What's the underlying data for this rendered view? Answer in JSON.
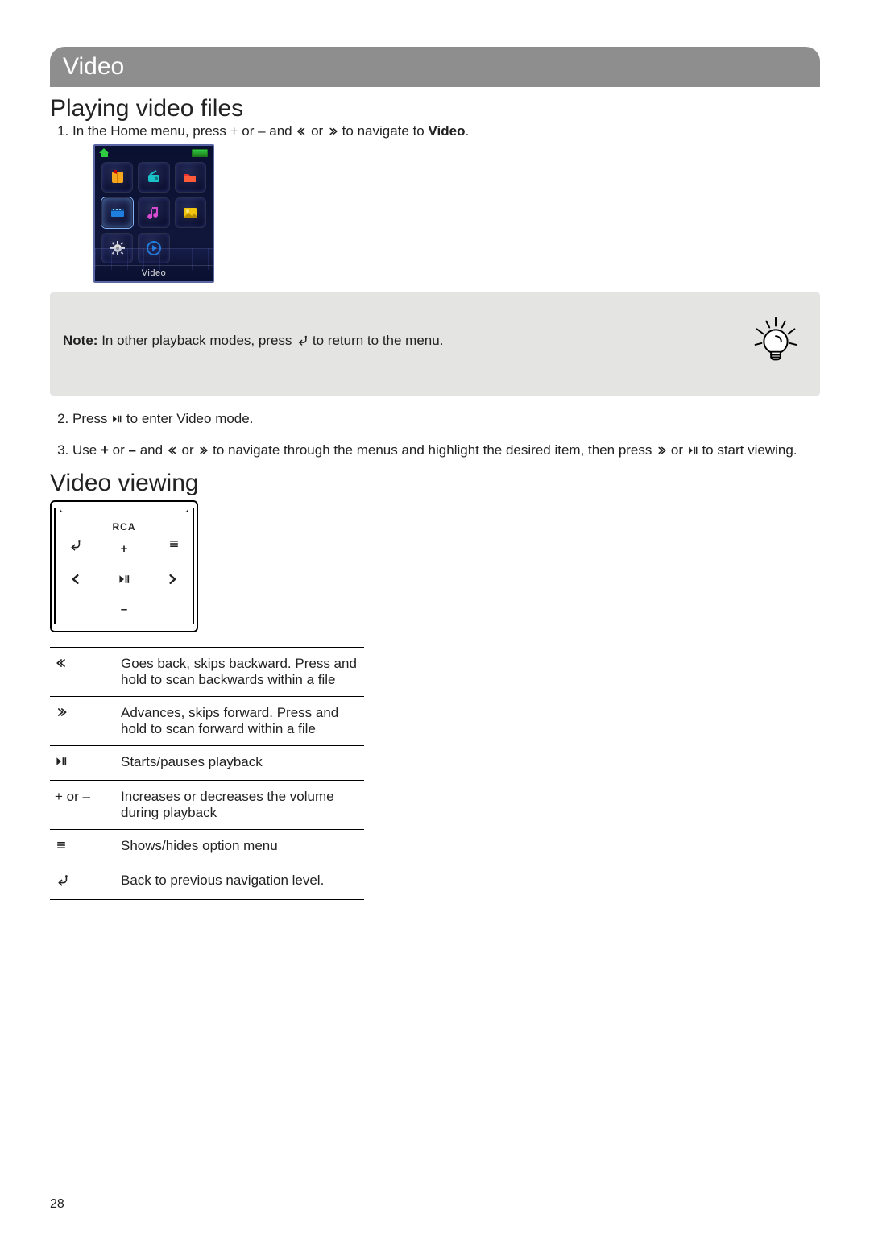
{
  "header": {
    "title": "Video"
  },
  "sections": {
    "playing": {
      "title": "Playing video files",
      "step1_pre": "In the Home menu, press + or – and ",
      "step1_mid": " or ",
      "step1_post": " to navigate to ",
      "step1_bold": "Video",
      "step1_end": ".",
      "device_label": "Video",
      "note_bold": "Note:",
      "note_rest": " In other playback modes, press ",
      "note_rest2": " to return to the menu.",
      "step2_pre": "Press ",
      "step2_post": " to enter Video mode.",
      "step3_pre": "Use ",
      "step3_a": "+",
      "step3_b": " or ",
      "step3_c": "–",
      "step3_d": " and ",
      "step3_e": " or ",
      "step3_f": " to navigate through the menus and highlight the desired item, then press ",
      "step3_g": " or ",
      "step3_h": " to start viewing."
    },
    "viewing": {
      "title": "Video viewing",
      "brand": "RCA"
    }
  },
  "controls_table": [
    {
      "key_icon": "skip-back-icon",
      "desc": "Goes back, skips backward. Press and hold to scan backwards within a file"
    },
    {
      "key_icon": "skip-fwd-icon",
      "desc": "Advances, skips forward. Press and hold to scan forward within a file"
    },
    {
      "key_icon": "play-pause-icon",
      "desc": "Starts/pauses playback"
    },
    {
      "key_text": "+ or –",
      "desc": "Increases or decreases the volume during playback"
    },
    {
      "key_icon": "menu-icon",
      "desc": "Shows/hides option menu"
    },
    {
      "key_icon": "back-icon",
      "desc": "Back to previous navigation level."
    }
  ],
  "page_number": "28",
  "icons": {
    "skip_back": "«",
    "skip_fwd": "»",
    "plus": "+",
    "minus": "–"
  }
}
